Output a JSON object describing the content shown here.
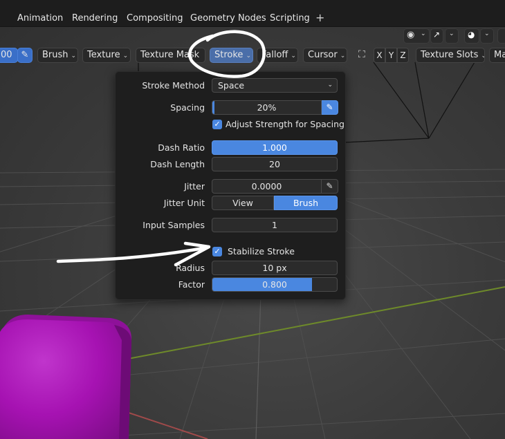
{
  "menubar": {
    "tabs": [
      "Animation",
      "Rendering",
      "Compositing",
      "Geometry Nodes",
      "Scripting"
    ],
    "add_tab": "+"
  },
  "toolbar": {
    "left_partial": "00",
    "brush": "Brush",
    "texture": "Texture",
    "texture_mask": "Texture Mask",
    "stroke": "Stroke",
    "falloff": "Falloff",
    "cursor": "Cursor",
    "symmetry_x": "X",
    "symmetry_y": "Y",
    "symmetry_z": "Z",
    "texture_slots": "Texture Slots",
    "right_partial": "Ma",
    "chevron": "⌄"
  },
  "stroke_panel": {
    "stroke_method": {
      "label": "Stroke Method",
      "value": "Space"
    },
    "spacing": {
      "label": "Spacing",
      "value": "20%",
      "fill": 0.02
    },
    "adjust_strength": {
      "label": "Adjust Strength for Spacing",
      "checked": true
    },
    "dash_ratio": {
      "label": "Dash Ratio",
      "value": "1.000"
    },
    "dash_length": {
      "label": "Dash Length",
      "value": "20"
    },
    "jitter": {
      "label": "Jitter",
      "value": "0.0000"
    },
    "jitter_unit": {
      "label": "Jitter Unit",
      "options": [
        "View",
        "Brush"
      ],
      "selected": "Brush"
    },
    "input_samples": {
      "label": "Input Samples",
      "value": "1"
    },
    "stabilize_stroke": {
      "label": "Stabilize Stroke",
      "checked": true
    },
    "radius": {
      "label": "Radius",
      "value": "10 px"
    },
    "factor": {
      "label": "Factor",
      "value": "0.800",
      "fill": 0.8
    }
  },
  "icons": {
    "check": "✓",
    "pen": "✎"
  },
  "colors": {
    "accent": "#4a87e0",
    "object": "#a812b4",
    "annotation": "#ffffff"
  }
}
